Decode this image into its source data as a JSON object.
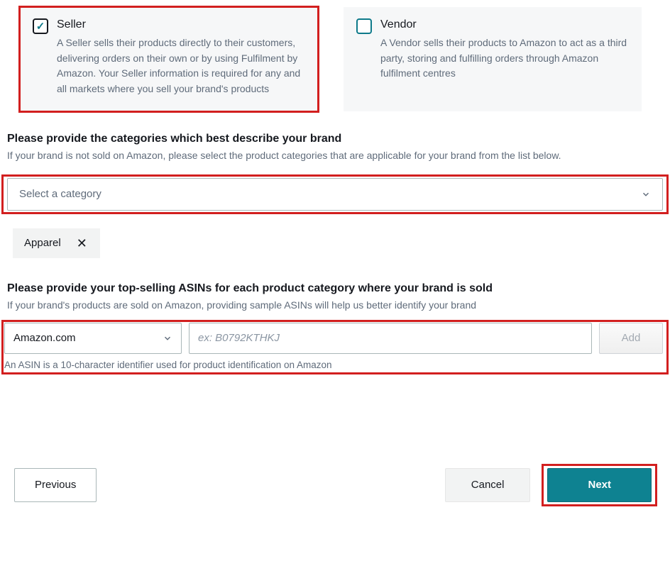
{
  "cards": {
    "seller": {
      "title": "Seller",
      "desc": "A Seller sells their products directly to their customers, delivering orders on their own or by using Fulfilment by Amazon. Your Seller information is required for any and all markets where you sell your brand's products",
      "checked": true
    },
    "vendor": {
      "title": "Vendor",
      "desc": "A Vendor sells their products to Amazon to act as a third party, storing and fulfilling orders through Amazon fulfilment centres",
      "checked": false
    }
  },
  "categories_section": {
    "heading": "Please provide the categories which best describe your brand",
    "sub": "If your brand is not sold on Amazon, please select the product categories that are applicable for your brand from the list below.",
    "select_placeholder": "Select a category",
    "selected_chips": [
      "Apparel"
    ]
  },
  "asin_section": {
    "heading": "Please provide your top-selling ASINs for each product category where your brand is sold",
    "sub": "If your brand's products are sold on Amazon, providing sample ASINs will help us better identify your brand",
    "marketplace": "Amazon.com",
    "asin_placeholder": "ex: B0792KTHKJ",
    "add_label": "Add",
    "note": "An ASIN is a 10-character identifier used for product identification on Amazon"
  },
  "footer": {
    "previous": "Previous",
    "cancel": "Cancel",
    "next": "Next"
  }
}
